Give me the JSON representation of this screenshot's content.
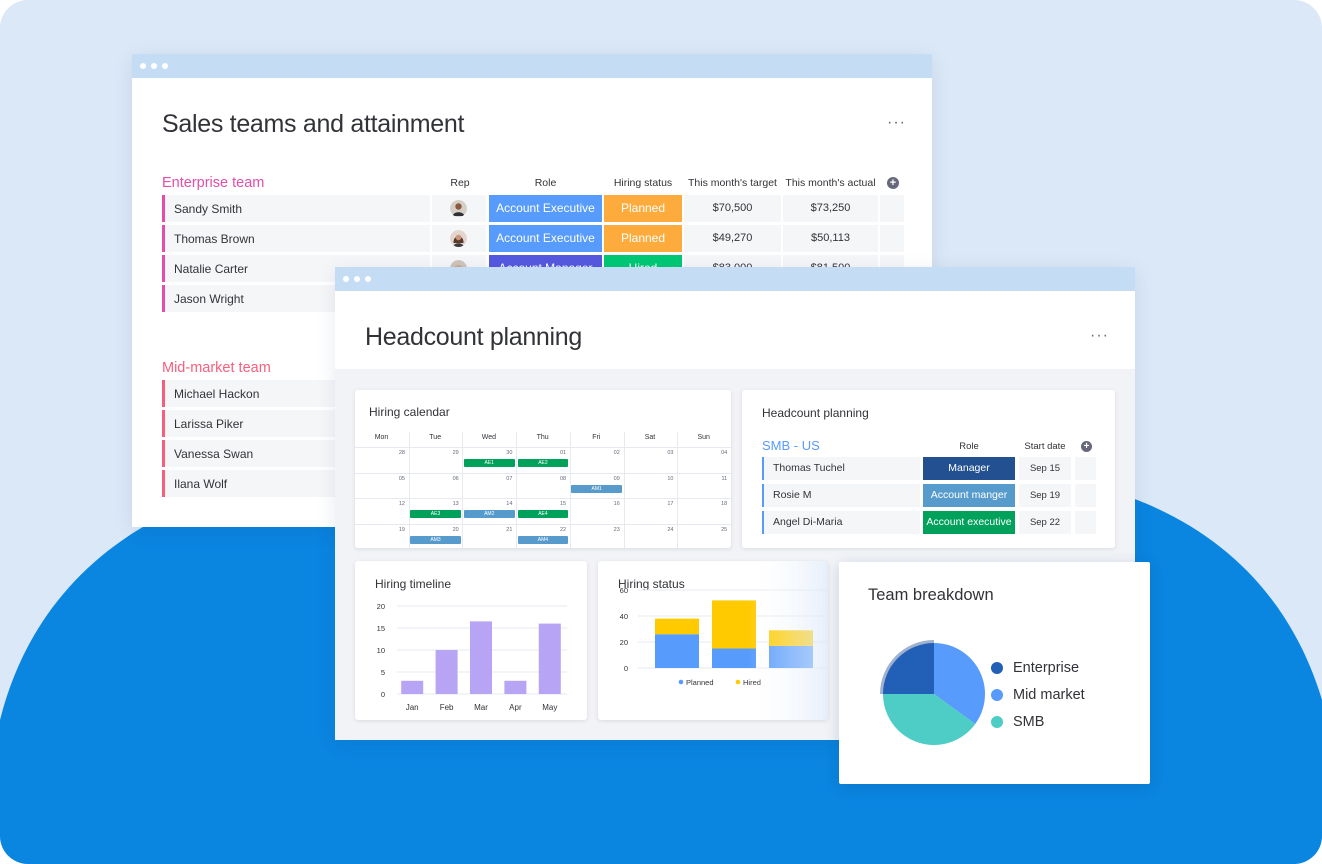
{
  "colors": {
    "background": "#dbe8f7",
    "blob": "#0a85e0",
    "enterprise_group": "#e44ea9",
    "midmarket_group": "#f65f7c",
    "account_executive": "#579bfc",
    "account_manager": "#5559df",
    "planned": "#fdab3d",
    "hired": "#00c875",
    "bar_purple": "#b7a4f5",
    "planned_blue": "#579bfc",
    "hired_yellow": "#ffcb00"
  },
  "sales_window": {
    "title": "Sales teams and attainment",
    "columns": {
      "rep": "Rep",
      "role": "Role",
      "hiring_status": "Hiring status",
      "target": "This month's target",
      "actual": "This month's actual"
    },
    "enterprise_team": {
      "title": "Enterprise team",
      "rows": [
        {
          "name": "Sandy Smith",
          "role": "Account Executive",
          "status": "Planned",
          "target": "$70,500",
          "actual": "$73,250"
        },
        {
          "name": "Thomas Brown",
          "role": "Account Executive",
          "status": "Planned",
          "target": "$49,270",
          "actual": "$50,113"
        },
        {
          "name": "Natalie Carter",
          "role": "Account Manager",
          "status": "Hired",
          "target": "$83,000",
          "actual": "$81,500"
        },
        {
          "name": "Jason Wright"
        }
      ]
    },
    "midmarket_team": {
      "title": "Mid-market team",
      "rows": [
        {
          "name": "Michael Hackon"
        },
        {
          "name": "Larissa Piker"
        },
        {
          "name": "Vanessa Swan"
        },
        {
          "name": "Ilana Wolf"
        }
      ]
    }
  },
  "headcount_window": {
    "title": "Headcount planning",
    "calendar": {
      "title": "Hiring calendar",
      "days": [
        "Mon",
        "Tue",
        "Wed",
        "Thu",
        "Fri",
        "Sat",
        "Sun"
      ],
      "weeks": [
        [
          "28",
          "29",
          "30",
          "01",
          "02",
          "03",
          "04"
        ],
        [
          "05",
          "06",
          "07",
          "08",
          "09",
          "10",
          "11"
        ],
        [
          "12",
          "13",
          "14",
          "15",
          "16",
          "17",
          "18"
        ],
        [
          "19",
          "20",
          "21",
          "22",
          "23",
          "24",
          "25"
        ]
      ],
      "events": [
        {
          "label": "AE1",
          "color": "#00a25b"
        },
        {
          "label": "AE2",
          "color": "#00a25b"
        },
        {
          "label": "AM1",
          "color": "#579bcc"
        },
        {
          "label": "AE3",
          "color": "#00a25b"
        },
        {
          "label": "AM2",
          "color": "#579bcc"
        },
        {
          "label": "AE4",
          "color": "#00a25b"
        },
        {
          "label": "AM3",
          "color": "#579bcc"
        },
        {
          "label": "AM4",
          "color": "#579bcc"
        }
      ]
    },
    "headcount_card": {
      "title": "Headcount planning",
      "group": "SMB - US",
      "col_role": "Role",
      "col_start": "Start date",
      "rows": [
        {
          "name": "Thomas Tuchel",
          "role": "Manager",
          "role_color": "#225091",
          "start": "Sep 15"
        },
        {
          "name": "Rosie M",
          "role": "Account manger",
          "role_color": "#579bcc",
          "start": "Sep 19"
        },
        {
          "name": "Angel Di-Maria",
          "role": "Account executive",
          "role_color": "#00a25b",
          "start": "Sep 22"
        }
      ]
    },
    "timeline_card": {
      "title": "Hiring timeline",
      "chart_data": {
        "type": "bar",
        "categories": [
          "Jan",
          "Feb",
          "Mar",
          "Apr",
          "May"
        ],
        "values": [
          3,
          10,
          16.5,
          3,
          16
        ],
        "ylim": [
          0,
          20
        ],
        "yticks": [
          "0",
          "5",
          "10",
          "15",
          "20"
        ],
        "grid": true
      }
    },
    "status_card": {
      "title": "Hiring status",
      "chart_data": {
        "type": "bar",
        "stacked": true,
        "categories": [
          "",
          "",
          ""
        ],
        "series": [
          {
            "name": "Planned",
            "values": [
              26,
              15,
              17
            ]
          },
          {
            "name": "Hired",
            "values": [
              12,
              37,
              12
            ]
          }
        ],
        "ylim": [
          0,
          60
        ],
        "yticks": [
          "0",
          "20",
          "40",
          "60"
        ],
        "legend": "bottom",
        "grid": true
      }
    }
  },
  "team_breakdown": {
    "title": "Team breakdown",
    "chart_data": {
      "type": "pie",
      "labels": [
        "Enterprise",
        "Mid market",
        "SMB"
      ],
      "values": [
        25,
        35,
        40
      ],
      "colors": [
        "#225fb7",
        "#579bfc",
        "#4eccc6"
      ]
    }
  }
}
